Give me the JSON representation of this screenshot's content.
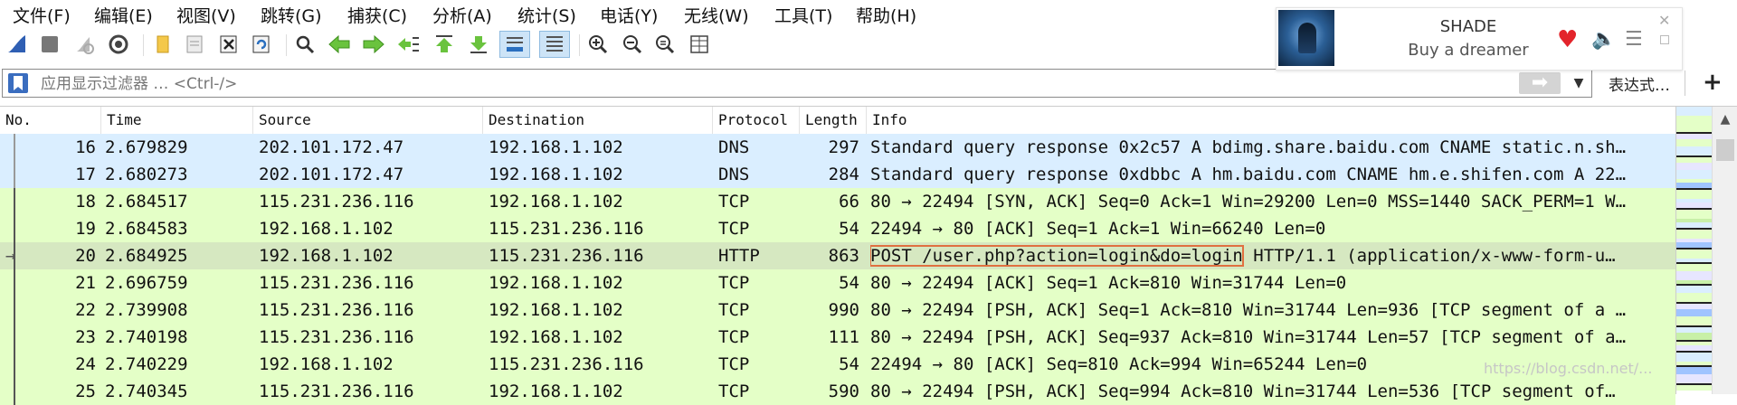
{
  "menubar": {
    "items": [
      "文件(F)",
      "编辑(E)",
      "视图(V)",
      "跳转(G)",
      "捕获(C)",
      "分析(A)",
      "统计(S)",
      "电话(Y)",
      "无线(W)",
      "工具(T)",
      "帮助(H)"
    ]
  },
  "music": {
    "title": "SHADE",
    "artist": "Buy a dreamer"
  },
  "filter": {
    "placeholder": "应用显示过滤器 … <Ctrl-/>",
    "expression_label": "表达式…",
    "plus_label": "+"
  },
  "packet_list": {
    "columns": [
      "No.",
      "Time",
      "Source",
      "Destination",
      "Protocol",
      "Length",
      "Info"
    ],
    "rows": [
      {
        "no": "16",
        "time": "2.679829",
        "src": "202.101.172.47",
        "dst": "192.168.1.102",
        "proto": "DNS",
        "len": "297",
        "info": "Standard query response 0x2c57 A bdimg.share.baidu.com CNAME static.n.sh…"
      },
      {
        "no": "17",
        "time": "2.680273",
        "src": "202.101.172.47",
        "dst": "192.168.1.102",
        "proto": "DNS",
        "len": "284",
        "info": "Standard query response 0xdbbc A hm.baidu.com CNAME hm.e.shifen.com A 22…"
      },
      {
        "no": "18",
        "time": "2.684517",
        "src": "115.231.236.116",
        "dst": "192.168.1.102",
        "proto": "TCP",
        "len": "66",
        "info": "80 → 22494 [SYN, ACK] Seq=0 Ack=1 Win=29200 Len=0 MSS=1440 SACK_PERM=1 W…"
      },
      {
        "no": "19",
        "time": "2.684583",
        "src": "192.168.1.102",
        "dst": "115.231.236.116",
        "proto": "TCP",
        "len": "54",
        "info": "22494 → 80 [ACK] Seq=1 Ack=1 Win=66240 Len=0"
      },
      {
        "no": "20",
        "time": "2.684925",
        "src": "192.168.1.102",
        "dst": "115.231.236.116",
        "proto": "HTTP",
        "len": "863",
        "info_highlight": "POST /user.php?action=login&do=login",
        "info_rest": " HTTP/1.1  (application/x-www-form-u…"
      },
      {
        "no": "21",
        "time": "2.696759",
        "src": "115.231.236.116",
        "dst": "192.168.1.102",
        "proto": "TCP",
        "len": "54",
        "info": "80 → 22494 [ACK] Seq=1 Ack=810 Win=31744 Len=0"
      },
      {
        "no": "22",
        "time": "2.739908",
        "src": "115.231.236.116",
        "dst": "192.168.1.102",
        "proto": "TCP",
        "len": "990",
        "info": "80 → 22494 [PSH, ACK] Seq=1 Ack=810 Win=31744 Len=936 [TCP segment of a …"
      },
      {
        "no": "23",
        "time": "2.740198",
        "src": "115.231.236.116",
        "dst": "192.168.1.102",
        "proto": "TCP",
        "len": "111",
        "info": "80 → 22494 [PSH, ACK] Seq=937 Ack=810 Win=31744 Len=57 [TCP segment of a…"
      },
      {
        "no": "24",
        "time": "2.740229",
        "src": "192.168.1.102",
        "dst": "115.231.236.116",
        "proto": "TCP",
        "len": "54",
        "info": "22494 → 80 [ACK] Seq=810 Ack=994 Win=65244 Len=0"
      },
      {
        "no": "25",
        "time": "2.740345",
        "src": "115.231.236.116",
        "dst": "192.168.1.102",
        "proto": "TCP",
        "len": "590",
        "info": "80 → 22494 [PSH, ACK] Seq=994 Ack=810 Win=31744 Len=536 [TCP segment of…"
      }
    ]
  },
  "colors": {
    "dns_row": "#daeeff",
    "http_row": "#e4ffc7",
    "selected_row": "#d6e8c1",
    "highlight_box": "#e07040",
    "heart": "#e3242b"
  },
  "watermark": "https://blog.csdn.net/..."
}
